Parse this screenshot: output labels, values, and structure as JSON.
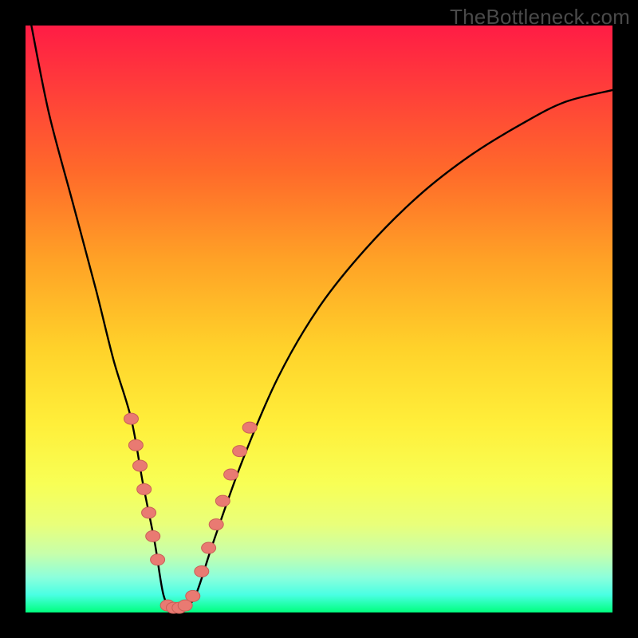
{
  "watermark": "TheBottleneck.com",
  "colors": {
    "background_frame": "#000000",
    "gradient_top": "#ff1c45",
    "gradient_bottom": "#00ff7e",
    "curve_stroke": "#000000",
    "marker_fill": "#e97a72",
    "marker_stroke": "#c95f57"
  },
  "chart_data": {
    "type": "line",
    "title": "",
    "xlabel": "",
    "ylabel": "",
    "xlim": [
      0,
      100
    ],
    "ylim": [
      0,
      100
    ],
    "note": "Axes are unlabeled; x and y are normalized to 0–100 based on the plot area. Lower y = closer to green (optimal).",
    "series": [
      {
        "name": "bottleneck-curve",
        "x": [
          1,
          4,
          8,
          12,
          15,
          18,
          20,
          22,
          23.5,
          25,
          27,
          29,
          32,
          37,
          43,
          50,
          58,
          67,
          76,
          85,
          92,
          100
        ],
        "y": [
          100,
          85,
          70,
          55,
          43,
          33,
          22,
          12,
          3,
          0.8,
          0.8,
          3,
          12,
          26,
          40,
          52,
          62,
          71,
          78,
          83.5,
          87,
          89
        ]
      }
    ],
    "markers": [
      {
        "x": 18.0,
        "y": 33.0
      },
      {
        "x": 18.8,
        "y": 28.5
      },
      {
        "x": 19.5,
        "y": 25.0
      },
      {
        "x": 20.2,
        "y": 21.0
      },
      {
        "x": 21.0,
        "y": 17.0
      },
      {
        "x": 21.7,
        "y": 13.0
      },
      {
        "x": 22.5,
        "y": 9.0
      },
      {
        "x": 24.2,
        "y": 1.2
      },
      {
        "x": 25.2,
        "y": 0.8
      },
      {
        "x": 26.2,
        "y": 0.8
      },
      {
        "x": 27.2,
        "y": 1.2
      },
      {
        "x": 28.5,
        "y": 2.8
      },
      {
        "x": 30.0,
        "y": 7.0
      },
      {
        "x": 31.2,
        "y": 11.0
      },
      {
        "x": 32.5,
        "y": 15.0
      },
      {
        "x": 33.6,
        "y": 19.0
      },
      {
        "x": 35.0,
        "y": 23.5
      },
      {
        "x": 36.5,
        "y": 27.5
      },
      {
        "x": 38.2,
        "y": 31.5
      }
    ]
  }
}
